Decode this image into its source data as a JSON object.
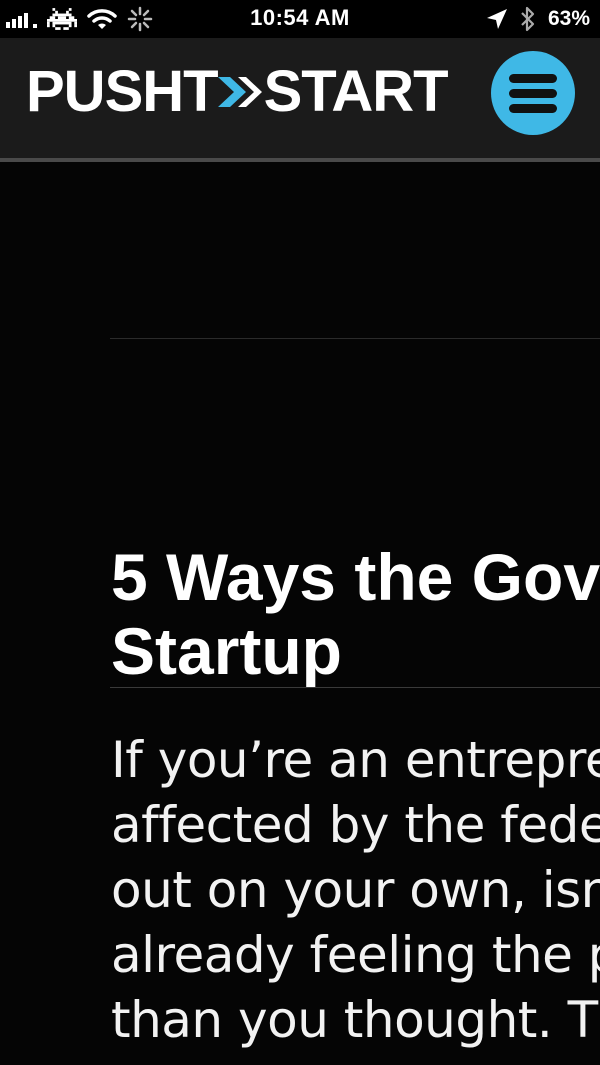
{
  "status_bar": {
    "time": "10:54 AM",
    "battery": "63%",
    "icons": [
      "signal-bars-icon",
      "game-invader-icon",
      "wifi-icon",
      "loading-spinner-icon",
      "location-arrow-icon",
      "bluetooth-icon"
    ]
  },
  "header": {
    "logo_part1": "PUSHT",
    "logo_part2": "START",
    "menu_icon": "hamburger-menu-icon",
    "accent_color": "#3fb8e6",
    "background_color": "#1b1b1b"
  },
  "article": {
    "title": "5 Ways the Gov\nStartup",
    "body": "If you’re an entrepre\naffected by the fede\nout on your own, isn\nalready feeling the p\nthan you thought. Th"
  }
}
